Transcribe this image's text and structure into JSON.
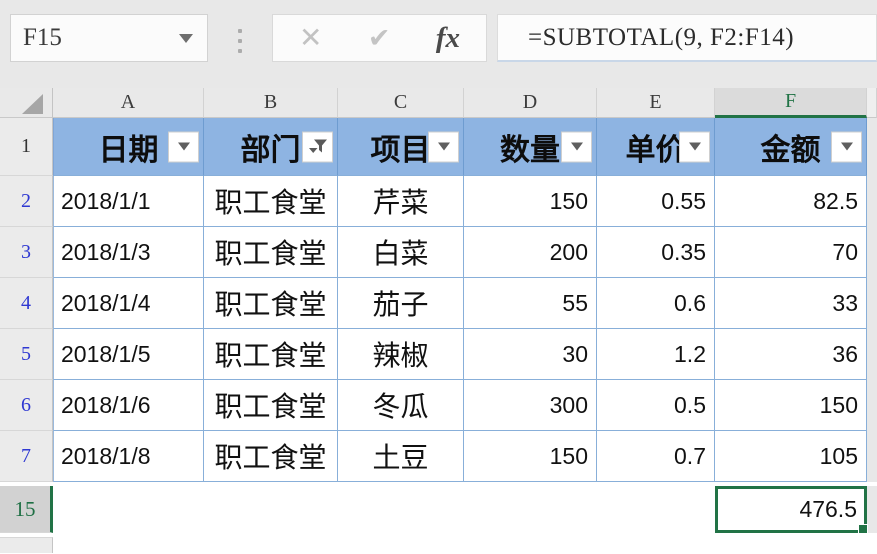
{
  "colors": {
    "accent_green": "#217346",
    "header_fill_blue": "#8EB4E2",
    "grid_border_blue": "#88AFD9",
    "filtered_row_number_blue": "#2F38D2"
  },
  "formula_bar": {
    "name_box_value": "F15",
    "cancel_icon": "✕",
    "enter_icon": "✔",
    "fx_label": "fx",
    "formula": "=SUBTOTAL(9, F2:F14)"
  },
  "grid": {
    "column_headers": [
      "A",
      "B",
      "C",
      "D",
      "E",
      "F"
    ],
    "selected_column": "F",
    "selected_row": "15"
  },
  "table": {
    "header_row_number": "1",
    "headers": [
      {
        "label": "日期",
        "filter": "arrow"
      },
      {
        "label": "部门",
        "filter": "funnel-active"
      },
      {
        "label": "项目",
        "filter": "arrow"
      },
      {
        "label": "数量",
        "filter": "arrow"
      },
      {
        "label": "单价",
        "filter": "arrow"
      },
      {
        "label": "金额",
        "filter": "arrow"
      }
    ],
    "rows": [
      {
        "row_number": "2",
        "date": "2018/1/1",
        "department": "职工食堂",
        "item": "芹菜",
        "quantity": "150",
        "unit_price": "0.55",
        "amount": "82.5"
      },
      {
        "row_number": "3",
        "date": "2018/1/3",
        "department": "职工食堂",
        "item": "白菜",
        "quantity": "200",
        "unit_price": "0.35",
        "amount": "70"
      },
      {
        "row_number": "4",
        "date": "2018/1/4",
        "department": "职工食堂",
        "item": "茄子",
        "quantity": "55",
        "unit_price": "0.6",
        "amount": "33"
      },
      {
        "row_number": "5",
        "date": "2018/1/5",
        "department": "职工食堂",
        "item": "辣椒",
        "quantity": "30",
        "unit_price": "1.2",
        "amount": "36"
      },
      {
        "row_number": "6",
        "date": "2018/1/6",
        "department": "职工食堂",
        "item": "冬瓜",
        "quantity": "300",
        "unit_price": "0.5",
        "amount": "150"
      },
      {
        "row_number": "7",
        "date": "2018/1/8",
        "department": "职工食堂",
        "item": "土豆",
        "quantity": "150",
        "unit_price": "0.7",
        "amount": "105"
      }
    ],
    "subtotal_row": {
      "row_number": "15",
      "amount": "476.5"
    }
  }
}
